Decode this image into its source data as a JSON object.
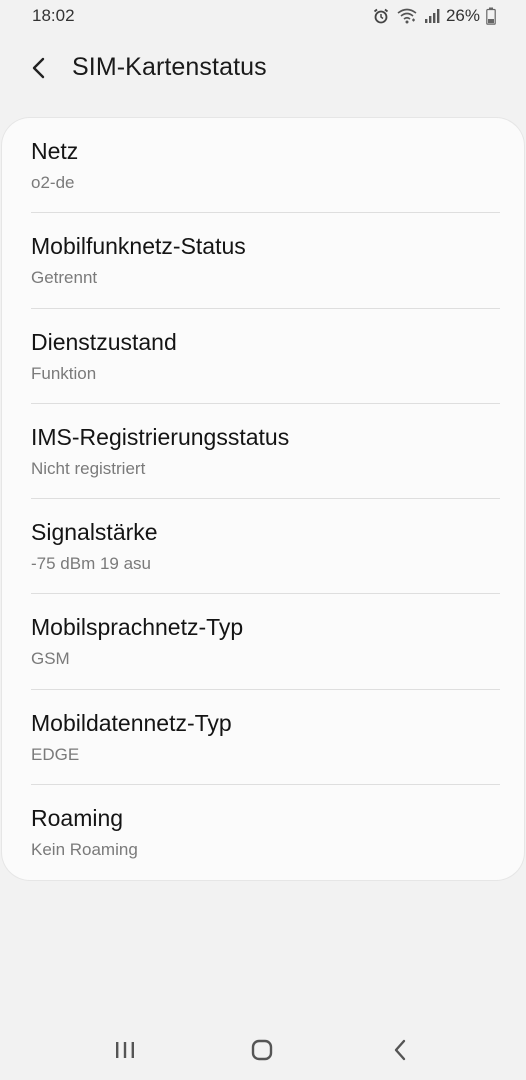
{
  "status_bar": {
    "time": "18:02",
    "battery": "26%",
    "icons": [
      "alarm-icon",
      "wifi-calling-icon",
      "signal-icon",
      "battery-icon"
    ]
  },
  "header": {
    "title": "SIM-Kartenstatus",
    "back_icon": "back-arrow-icon"
  },
  "items": [
    {
      "title": "Netz",
      "value": "o2-de"
    },
    {
      "title": "Mobilfunknetz-Status",
      "value": "Getrennt"
    },
    {
      "title": "Dienstzustand",
      "value": "Funktion"
    },
    {
      "title": "IMS-Registrierungsstatus",
      "value": "Nicht registriert"
    },
    {
      "title": "Signalstärke",
      "value": "-75 dBm 19 asu"
    },
    {
      "title": "Mobilsprachnetz-Typ",
      "value": "GSM"
    },
    {
      "title": "Mobildatennetz-Typ",
      "value": "EDGE"
    },
    {
      "title": "Roaming",
      "value": "Kein Roaming"
    }
  ],
  "nav_bar": {
    "icons": [
      "recent-apps-icon",
      "home-icon",
      "back-icon"
    ]
  },
  "colors": {
    "background": "#f2f2f2",
    "card": "#fbfbfb",
    "primary_text": "#141414",
    "secondary_text": "#7a7a7a"
  }
}
